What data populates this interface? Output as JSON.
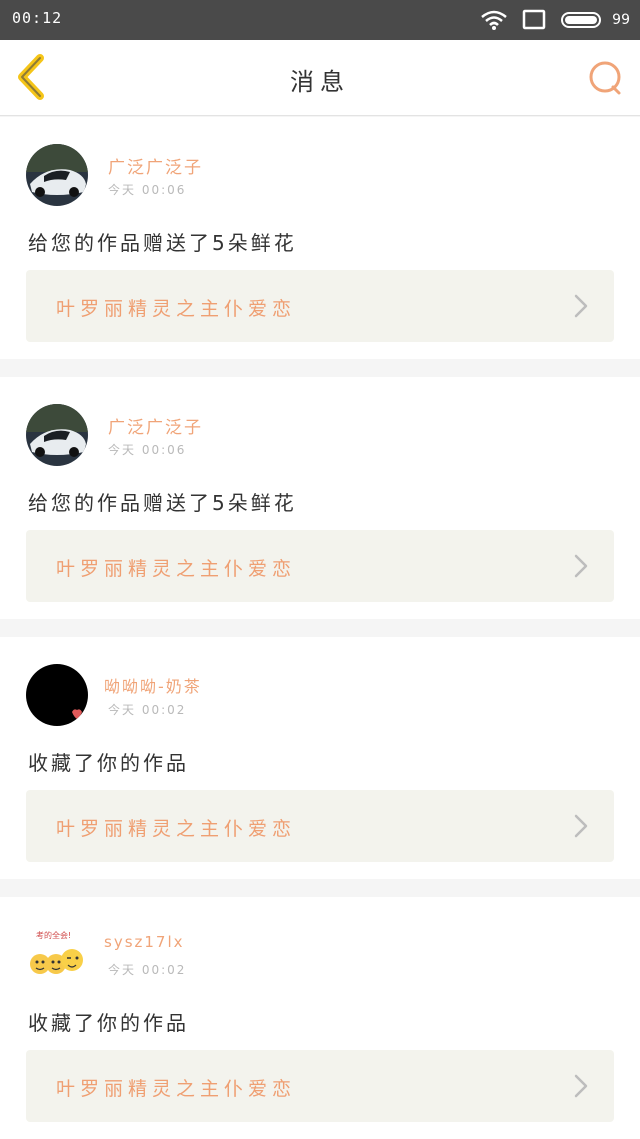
{
  "status_bar": {
    "time": "00:12",
    "battery": "99"
  },
  "header": {
    "title": "消息"
  },
  "messages": [
    {
      "user": "广泛广泛子",
      "time": "今天 00:06",
      "action": "给您的作品赠送了5朵鲜花",
      "work": "叶罗丽精灵之主仆爱恋"
    },
    {
      "user": "广泛广泛子",
      "time": "今天 00:06",
      "action": "给您的作品赠送了5朵鲜花",
      "work": "叶罗丽精灵之主仆爱恋"
    },
    {
      "user": "呦呦呦-奶茶",
      "time": "今天 00:02",
      "action": "收藏了你的作品",
      "work": "叶罗丽精灵之主仆爱恋"
    },
    {
      "user": "sysz17lx",
      "time": "今天 00:02",
      "action": "收藏了你的作品",
      "work": "叶罗丽精灵之主仆爱恋",
      "avatar_caption": "考的全会!"
    }
  ],
  "colors": {
    "accent": "#f0a478",
    "back_arrow": "#f5c518",
    "card_bg": "#f3f3ed"
  }
}
